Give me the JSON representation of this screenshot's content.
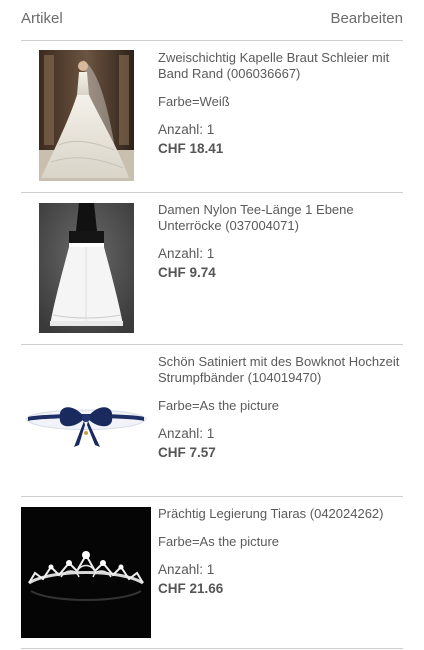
{
  "header": {
    "title": "Artikel",
    "edit_label": "Bearbeiten"
  },
  "items": [
    {
      "name": "Zweischichtig Kapelle Braut Schleier mit Band Rand (006036667)",
      "attribute": "Farbe=Weiß",
      "quantity": "Anzahl: 1",
      "price": "CHF 18.41",
      "image": "wedding-dress-veil-photo"
    },
    {
      "name": "Damen Nylon Tee-Länge 1 Ebene Unterröcke (037004071)",
      "attribute": "",
      "quantity": "Anzahl: 1",
      "price": "CHF 9.74",
      "image": "petticoat-photo"
    },
    {
      "name": "Schön Satiniert mit des Bowknot Hochzeit Strumpfbänder (104019470)",
      "attribute": "Farbe=As the picture",
      "quantity": "Anzahl: 1",
      "price": "CHF 7.57",
      "image": "garter-photo"
    },
    {
      "name": "Prächtig Legierung Tiaras (042024262)",
      "attribute": "Farbe=As the picture",
      "quantity": "Anzahl: 1",
      "price": "CHF 21.66",
      "image": "tiara-photo"
    }
  ]
}
